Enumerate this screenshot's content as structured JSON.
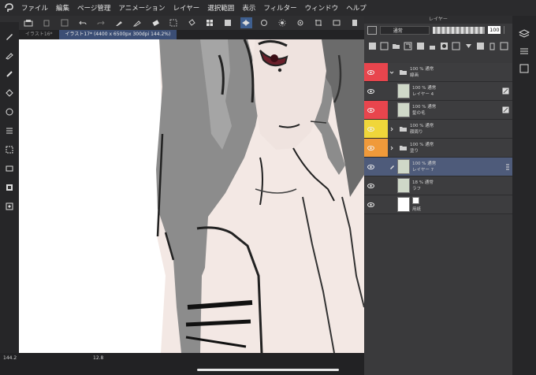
{
  "menu": [
    "ファイル",
    "編集",
    "ページ管理",
    "アニメーション",
    "レイヤー",
    "選択範囲",
    "表示",
    "フィルター",
    "ウィンドウ",
    "ヘルプ"
  ],
  "tabs": [
    {
      "label": "イラスト16*",
      "active": false
    },
    {
      "label": "イラスト17* (4400 x 6500px 300dpi 144.2%)",
      "active": true
    }
  ],
  "status": {
    "zoom": "144.2",
    "angle": "12.8"
  },
  "layer_panel": {
    "title": "レイヤー",
    "blend_mode": "通常",
    "opacity": "100",
    "layers": [
      {
        "pct": "100 %",
        "mode": "通常",
        "name": "線画",
        "eye": "red",
        "lock": "red",
        "folder": true,
        "expand": "open",
        "thumb": false,
        "selected": false,
        "right_icon": false
      },
      {
        "pct": "100 %",
        "mode": "通常",
        "name": "レイヤー 4",
        "eye": "none",
        "lock": "none",
        "folder": false,
        "expand": "none",
        "thumb": true,
        "selected": false,
        "right_icon": true
      },
      {
        "pct": "100 %",
        "mode": "通常",
        "name": "髪の毛",
        "eye": "red",
        "lock": "red",
        "folder": false,
        "expand": "none",
        "thumb": true,
        "selected": false,
        "right_icon": true
      },
      {
        "pct": "100 %",
        "mode": "通常",
        "name": "顔周り",
        "eye": "yellow",
        "lock": "yellow",
        "folder": true,
        "expand": "closed",
        "thumb": false,
        "selected": false,
        "right_icon": false
      },
      {
        "pct": "100 %",
        "mode": "通常",
        "name": "塗り",
        "eye": "orange",
        "lock": "orange",
        "folder": true,
        "expand": "closed",
        "thumb": false,
        "selected": false,
        "right_icon": false
      },
      {
        "pct": "100 %",
        "mode": "通常",
        "name": "レイヤー 7",
        "eye": "none",
        "lock": "none",
        "folder": false,
        "expand": "none",
        "thumb": true,
        "selected": true,
        "right_icon": false
      },
      {
        "pct": "18 %",
        "mode": "通常",
        "name": "ラフ",
        "eye": "none",
        "lock": "none",
        "folder": false,
        "expand": "none",
        "thumb": true,
        "selected": false,
        "right_icon": false
      },
      {
        "pct": "",
        "mode": "",
        "name": "用紙",
        "eye": "none",
        "lock": "none",
        "folder": false,
        "expand": "none",
        "thumb": false,
        "selected": false,
        "right_icon": false
      }
    ]
  },
  "colors": {
    "red": "#e8454d",
    "yellow": "#f0d63a",
    "orange": "#f09a3a",
    "selected": "#4e5b7a",
    "accent": "#3f5f8f"
  }
}
